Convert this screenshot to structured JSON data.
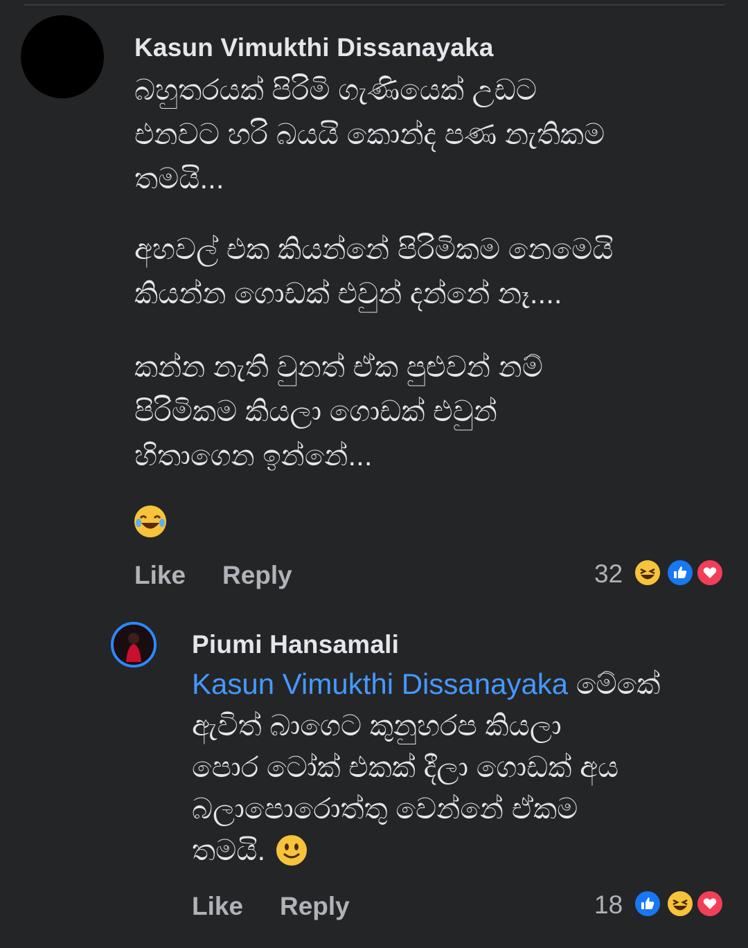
{
  "comment": {
    "author": "Kasun Vimukthi Dissanayaka",
    "paragraph_1": "බහුතරයක් පිරිමි ගැණියෙක් උඩට\nඑනවට හරි බයයි කොන්ද පණ නැතිකම\nතමයි...",
    "paragraph_2": "අහවල් එක කියන්නේ පිරිමිකම නෙමෙයි\nකියන්න  ගොඩක් එවුන් දන්නේ නෑ....",
    "paragraph_3": "කන්න නැති වුනත් ඒක පුළුවන් නම්\nපිරිමිකම කියලා ගොඩක් එවුන්\nහිතාගෙන ඉන්නේ...",
    "emoji_icon": "laughing-tears-emoji-icon",
    "like_label": "Like",
    "reply_label": "Reply",
    "reaction_count": "32",
    "reaction_icons": [
      "haha-icon",
      "like-icon",
      "love-icon"
    ]
  },
  "reply": {
    "author": "Piumi Hansamali",
    "mention": "Kasun Vimukthi Dissanayaka",
    "text": " මේකේ\nඇවිත් බාගෙට කුනුහරප කියලා\nපොර ටෝක් එකක් දීලා ගොඩක් අය\nබලාපොරොත්තු වෙන්නේ ඒකම\nතමයි. ",
    "emoji_icon": "smiling-face-emoji-icon",
    "like_label": "Like",
    "reply_label": "Reply",
    "reaction_count": "18",
    "reaction_icons": [
      "like-icon",
      "haha-icon",
      "love-icon"
    ]
  },
  "colors": {
    "background": "#242527",
    "primary_text": "#e4e6eb",
    "secondary_text": "#b0b3b8",
    "mention": "#4599ff",
    "like_blue": "#1877f2",
    "love_red": "#f33e58",
    "haha_yellow": "#f7c33b"
  }
}
